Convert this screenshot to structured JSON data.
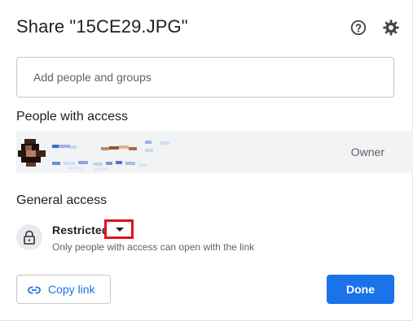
{
  "dialog": {
    "title": "Share \"15CE29.JPG\"",
    "help_icon": "help-circle-icon",
    "settings_icon": "gear-icon"
  },
  "add_people": {
    "placeholder": "Add people and groups"
  },
  "people_with_access": {
    "heading": "People with access",
    "people": [
      {
        "avatar": "user-avatar (pixelated)",
        "name": "",
        "email": "",
        "role": "Owner"
      }
    ]
  },
  "general_access": {
    "heading": "General access",
    "icon": "lock-icon",
    "selected_value": "Restricted",
    "dropdown_icon": "caret-down-icon",
    "description": "Only people with access can open with the link"
  },
  "footer": {
    "copy_link_icon": "link-icon",
    "copy_link_label": "Copy link",
    "done_label": "Done"
  },
  "colors": {
    "primary": "#1a73e8",
    "highlight_box": "#e0101e",
    "row_background": "#f1f3f4"
  }
}
